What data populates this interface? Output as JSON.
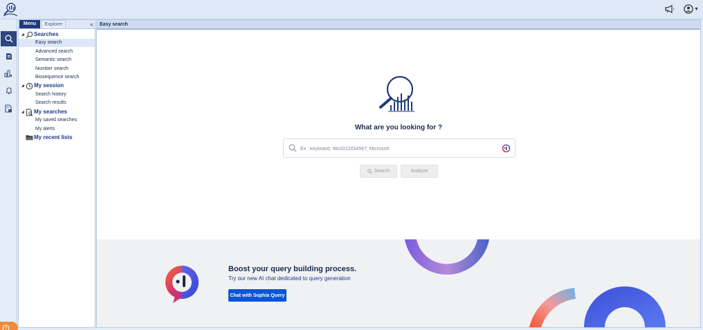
{
  "sidebar_tabs": {
    "menu": "Menu",
    "explorer": "Explorer",
    "collapse": "«"
  },
  "tree": {
    "searches": {
      "label": "Searches",
      "items": [
        "Easy search",
        "Advanced search",
        "Semantic search",
        "Number search",
        "Biosequence search"
      ]
    },
    "session": {
      "label": "My session",
      "items": [
        "Search history",
        "Search results"
      ]
    },
    "my_searches": {
      "label": "My searches",
      "items": [
        "My saved searches",
        "My alerts"
      ]
    },
    "recent_lists": {
      "label": "My recent lists"
    }
  },
  "main": {
    "header": "Easy search",
    "question": "What are you looking for ?",
    "search_placeholder": "Ex : keyboard, Wo2012034567, Microsoft",
    "search_button": "Search",
    "analyze_button": "Analyze"
  },
  "promo": {
    "title": "Boost your query building process.",
    "subtitle": "Try our new AI chat dedicated to query generation",
    "button": "Chat with Sophia Query"
  },
  "colors": {
    "accent": "#2f4680",
    "brand_blue": "#0a55d6",
    "help_tab": "#f08a3c",
    "panel_border": "#b8c9e4"
  },
  "icons": [
    "logo-icon",
    "megaphone-icon",
    "user-account-icon",
    "search-icon",
    "library-icon",
    "chart-icon",
    "bell-icon",
    "document-icon",
    "help-icon"
  ]
}
